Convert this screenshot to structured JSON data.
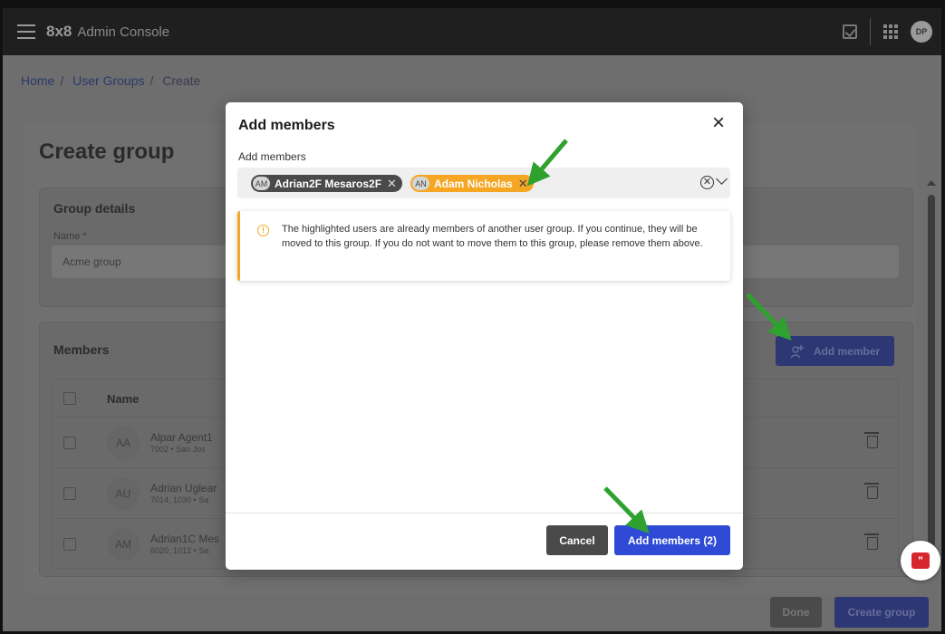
{
  "app": {
    "brand": "8x8",
    "title": "Admin Console",
    "user_initials": "DP"
  },
  "breadcrumb": {
    "items": [
      "Home",
      "User Groups",
      "Create"
    ],
    "separator": "/"
  },
  "page": {
    "title": "Create group",
    "details": {
      "heading": "Group details",
      "name_label": "Name *",
      "name_value": "Acme group"
    },
    "members": {
      "heading": "Members",
      "add_button": "Add member",
      "column_name": "Name",
      "rows": [
        {
          "initials": "AA",
          "name": "Alpar Agent1",
          "sub": "7002 • San Jos"
        },
        {
          "initials": "AU",
          "name": "Adrian Uglear",
          "sub": "7014, 1030 • Sa"
        },
        {
          "initials": "AM",
          "name": "Adrian1C Mes",
          "sub": "6020, 1012 • Sa"
        }
      ]
    },
    "done_button": "Done",
    "create_button": "Create group"
  },
  "modal": {
    "title": "Add members",
    "field_label": "Add members",
    "chips": [
      {
        "initials": "AM",
        "name": "Adrian2F Mesaros2F",
        "highlighted": false
      },
      {
        "initials": "AN",
        "name": "Adam Nicholas",
        "highlighted": true
      }
    ],
    "alert": "The highlighted users are already members of another user group. If you continue, they will be moved to this group. If you do not want to move them to this group, please remove them above.",
    "cancel_button": "Cancel",
    "add_button": "Add members (2)"
  },
  "colors": {
    "accent": "#2f4bd6",
    "warning": "#f5a623",
    "annotation_arrow": "#2fa12f"
  },
  "icons": [
    "menu-icon",
    "tasks-icon",
    "apps-grid-icon",
    "close-icon",
    "clear-icon",
    "chevron-down-icon",
    "warning-icon",
    "add-person-icon",
    "trash-icon",
    "chat-icon"
  ]
}
